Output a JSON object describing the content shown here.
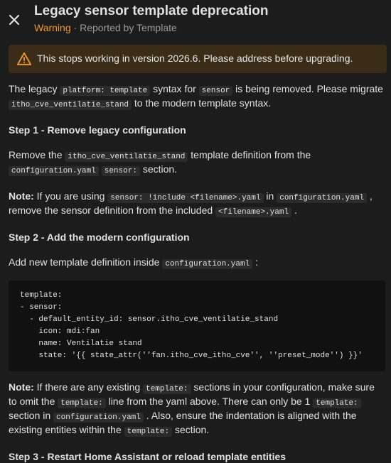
{
  "dialog": {
    "title": "Legacy sensor template deprecation",
    "severity": "Warning",
    "separator": " · ",
    "reporter": "Reported by Template"
  },
  "alert": {
    "icon": "warning-icon",
    "color": "#ef9a2a",
    "text": "This stops working in version 2026.6. Please address before upgrading."
  },
  "intro": {
    "t1": "The legacy ",
    "c1": "platform: template",
    "t2": " syntax for ",
    "c2": "sensor",
    "t3": " is being removed. Please migrate ",
    "c3": "itho_cve_ventilatie_stand",
    "t4": " to the modern template syntax."
  },
  "step1": {
    "heading": "Step 1 - Remove legacy configuration",
    "p1": {
      "t1": "Remove the ",
      "c1": "itho_cve_ventilatie_stand",
      "t2": " template definition from the ",
      "c2": "configuration.yaml",
      "t3": " ",
      "c3": "sensor:",
      "t4": " section."
    },
    "note": {
      "label": "Note:",
      "t1": " If you are using ",
      "c1": "sensor: !include <filename>.yaml",
      "t2": " in ",
      "c2": "configuration.yaml",
      "t3": " , remove the sensor definition from the included ",
      "c3": "<filename>.yaml",
      "t4": " ."
    }
  },
  "step2": {
    "heading": "Step 2 - Add the modern configuration",
    "p1": {
      "t1": "Add new template definition inside ",
      "c1": "configuration.yaml",
      "t2": " :"
    },
    "code": "template:\n- sensor:\n  - default_entity_id: sensor.itho_cve_ventilatie_stand\n    icon: mdi:fan\n    name: Ventilatie stand\n    state: '{{ state_attr(''fan.itho_cve_itho_cve'', ''preset_mode'') }}'",
    "note": {
      "label": "Note:",
      "t1": " If there are any existing ",
      "c1": "template:",
      "t2": " sections in your configuration, make sure to omit the ",
      "c2": "template:",
      "t3": " line from the yaml above. There can only be 1 ",
      "c3": "template:",
      "t4": " section in ",
      "c4": "configuration.yaml",
      "t5": " . Also, ensure the indentation is aligned with the existing entities within the ",
      "c5": "template:",
      "t6": " section."
    }
  },
  "step3": {
    "heading": "Step 3 - Restart Home Assistant or reload template entities"
  }
}
